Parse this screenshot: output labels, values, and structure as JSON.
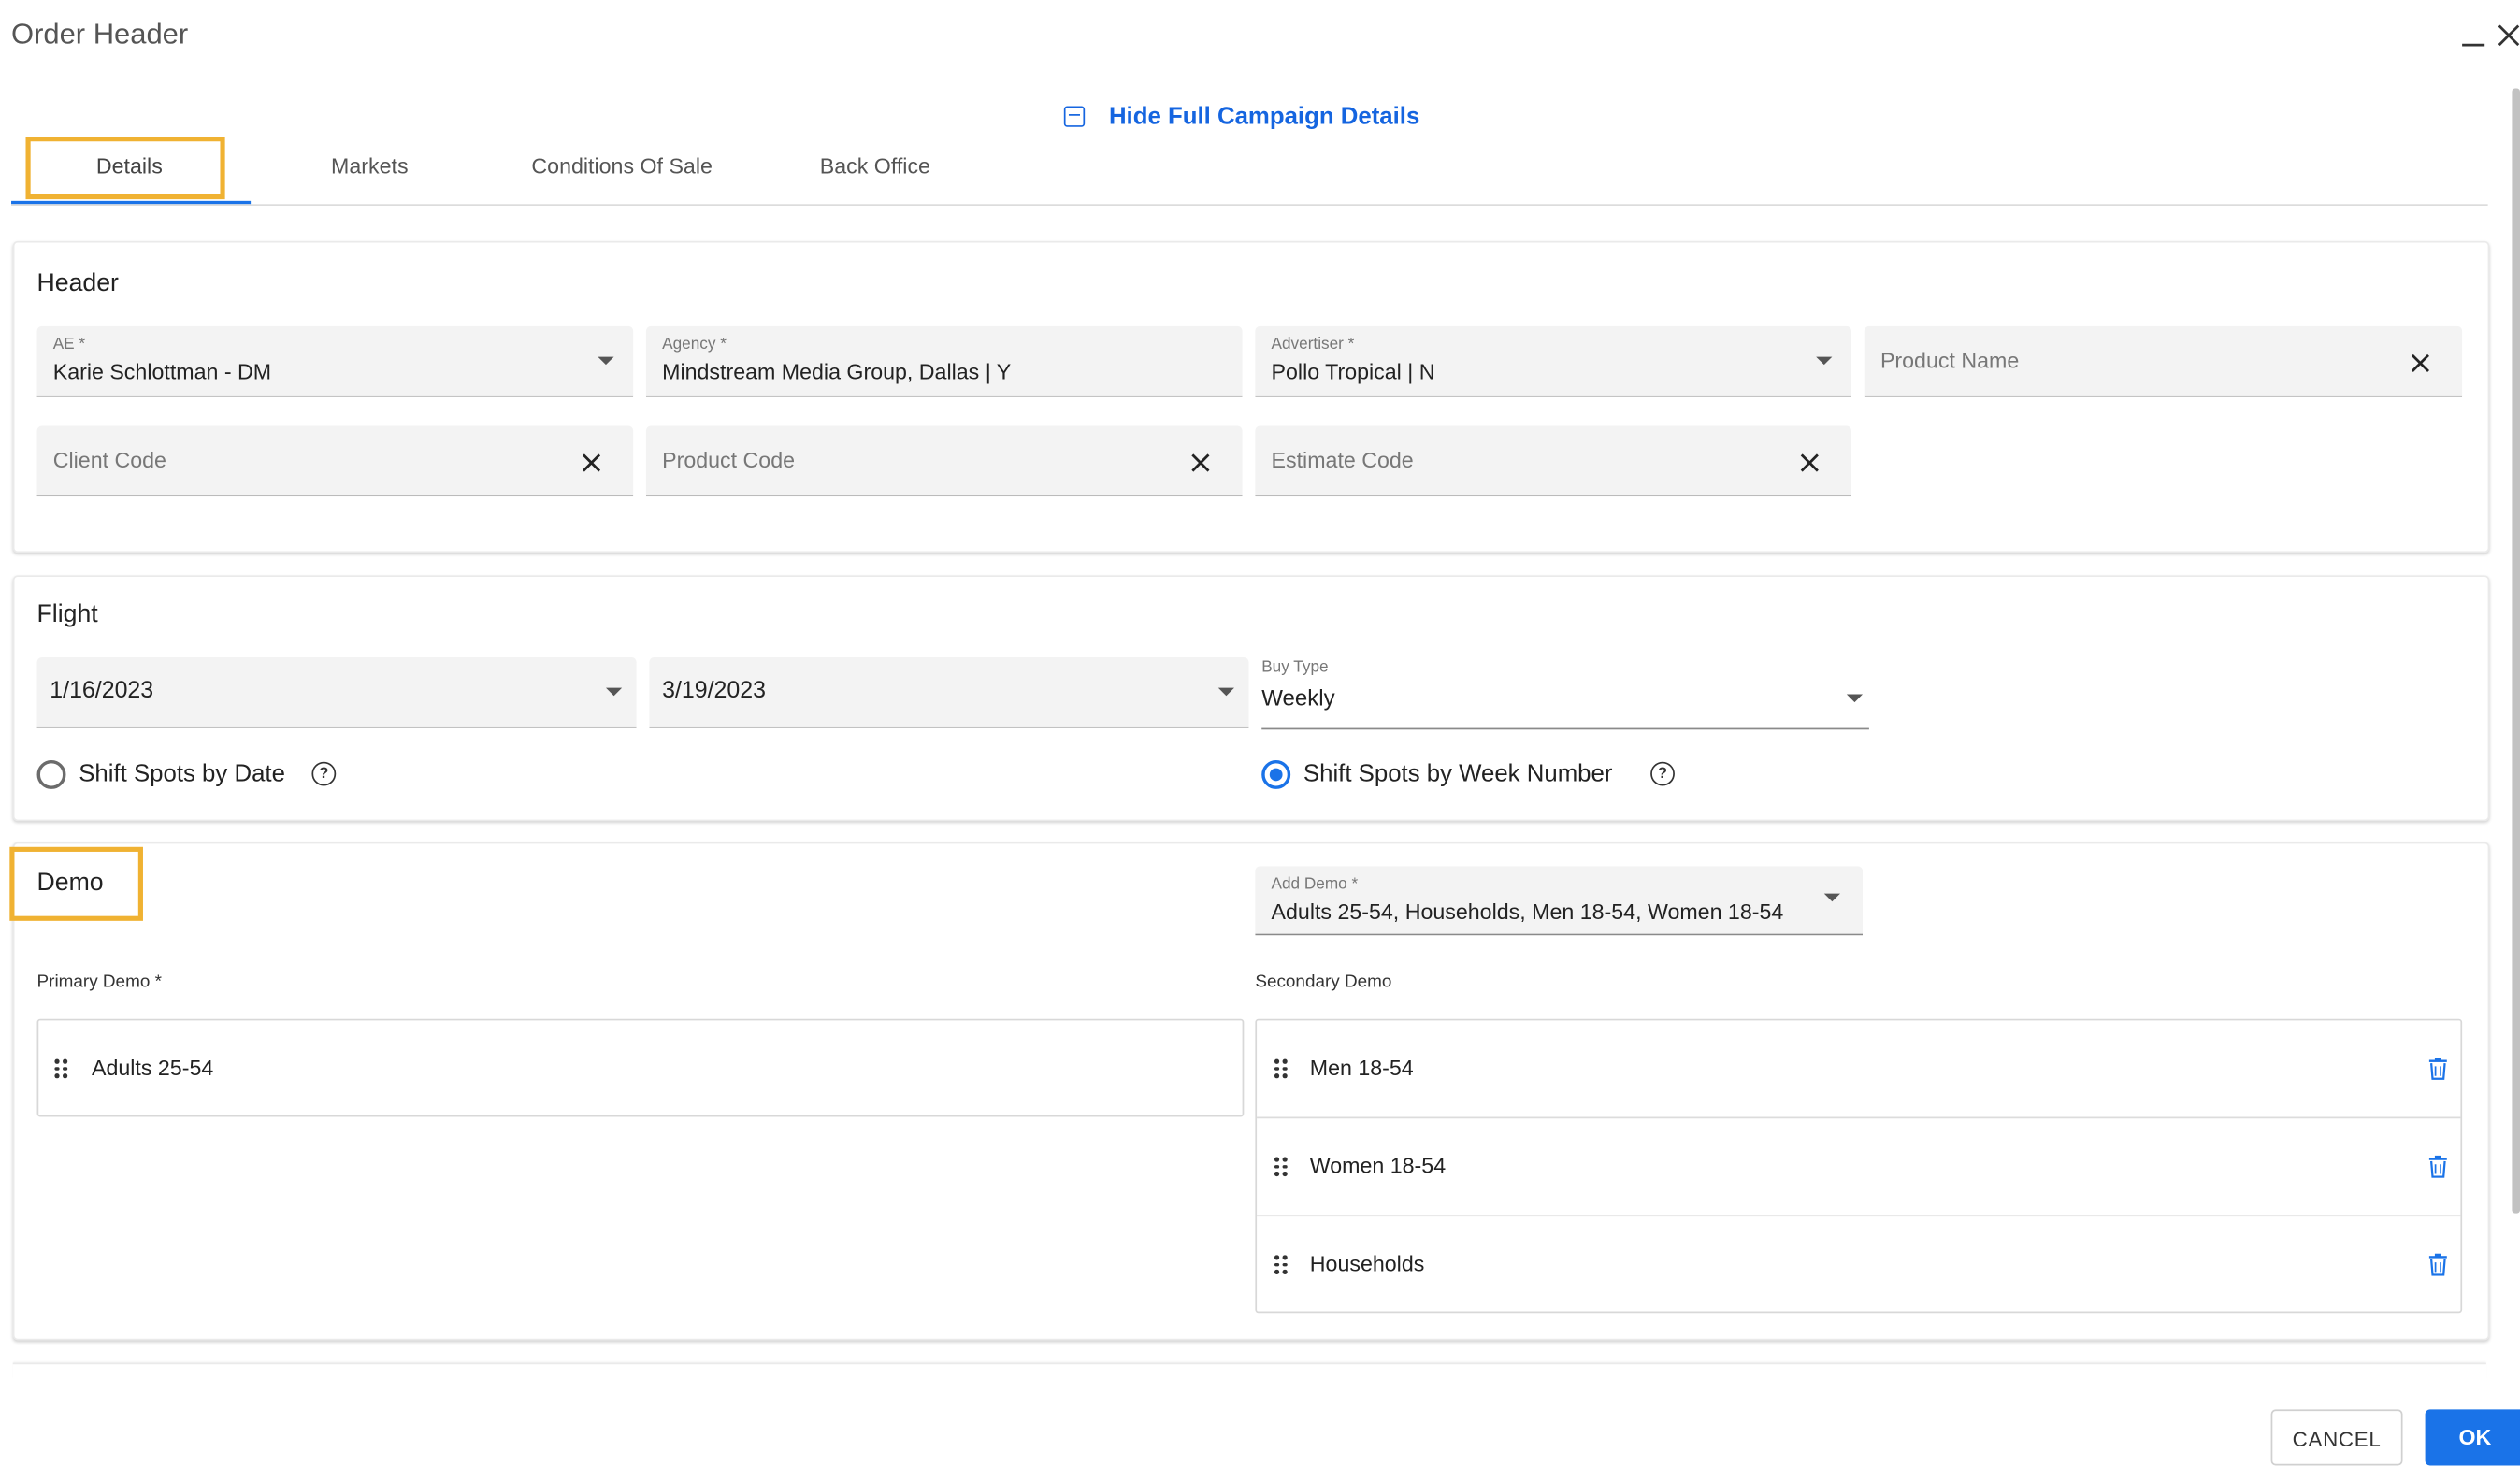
{
  "window": {
    "title": "Order Header"
  },
  "toggle_details_label": "Hide Full Campaign Details",
  "tabs": [
    {
      "label": "Details",
      "active": true
    },
    {
      "label": "Markets"
    },
    {
      "label": "Conditions Of Sale"
    },
    {
      "label": "Back Office"
    }
  ],
  "header_section": {
    "title": "Header",
    "ae": {
      "label": "AE *",
      "value": "Karie Schlottman - DM"
    },
    "agency": {
      "label": "Agency *",
      "value": "Mindstream Media Group, Dallas | Y"
    },
    "advertiser": {
      "label": "Advertiser *",
      "value": "Pollo Tropical | N"
    },
    "product_name": {
      "placeholder": "Product Name"
    },
    "client_code": {
      "placeholder": "Client Code"
    },
    "product_code": {
      "placeholder": "Product Code"
    },
    "estimate_code": {
      "placeholder": "Estimate Code"
    }
  },
  "flight_section": {
    "title": "Flight",
    "start_date": "1/16/2023",
    "end_date": "3/19/2023",
    "buy_type": {
      "label": "Buy Type",
      "value": "Weekly"
    },
    "shift_by_date": {
      "label": "Shift Spots by Date",
      "selected": false
    },
    "shift_by_week": {
      "label": "Shift Spots by Week Number",
      "selected": true
    },
    "help_glyph": "?"
  },
  "demo_section": {
    "title": "Demo",
    "add_demo": {
      "label": "Add Demo *",
      "value": "Adults 25-54, Households, Men 18-54, Women 18-54"
    },
    "primary_label": "Primary Demo *",
    "primary": [
      "Adults 25-54"
    ],
    "secondary_label": "Secondary Demo",
    "secondary": [
      "Men 18-54",
      "Women 18-54",
      "Households"
    ]
  },
  "footer": {
    "cancel_label": "CANCEL",
    "ok_label": "OK"
  },
  "colors": {
    "accent": "#1a73e8",
    "highlight": "#f0b232",
    "field_bg": "#f3f3f3"
  }
}
